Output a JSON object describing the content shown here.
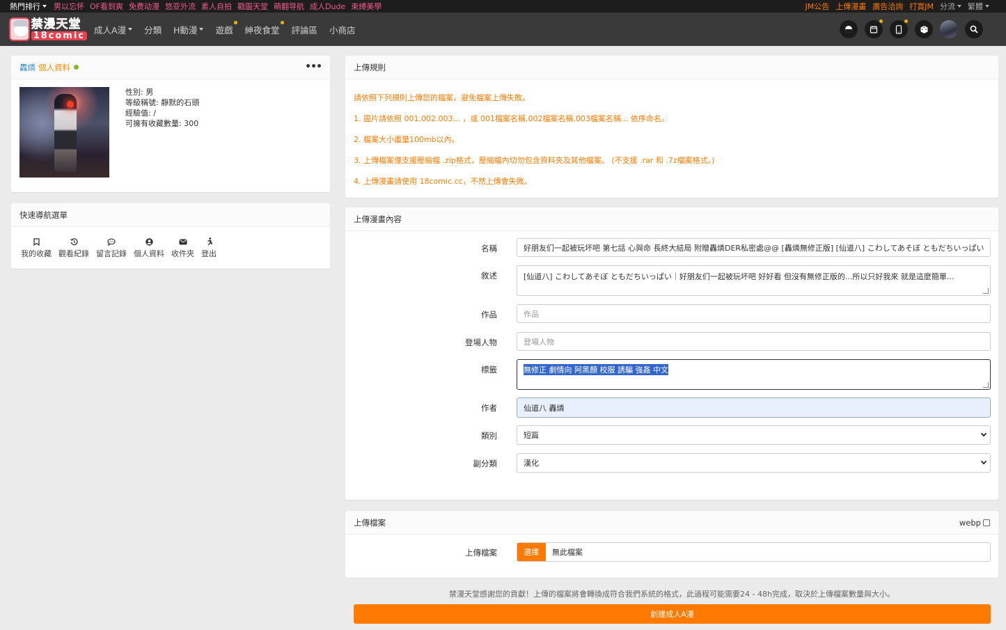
{
  "topbar": {
    "hot_label": "熱門排行",
    "links": [
      "男以忘怀",
      "OF看到爽",
      "免费动漫",
      "悠亚外流",
      "素人自拍",
      "戳圖天堂",
      "萌翻导航",
      "成人Dude",
      "束縛美學"
    ],
    "right_links": [
      "JM公告",
      "上傳漫畫",
      "廣告洽詢",
      "打賞JM"
    ],
    "split_label": "分流",
    "lang_label": "繁體"
  },
  "logo": {
    "line1": "禁漫天堂",
    "line2": "18comic"
  },
  "nav": {
    "items": [
      {
        "label": "成人A漫",
        "dropdown": true,
        "dot": false
      },
      {
        "label": "分類",
        "dropdown": false,
        "dot": false
      },
      {
        "label": "H動漫",
        "dropdown": true,
        "dot": false
      },
      {
        "label": "遊戲",
        "dropdown": false,
        "dot": true
      },
      {
        "label": "紳夜食堂",
        "dropdown": false,
        "dot": true
      },
      {
        "label": "評論區",
        "dropdown": false,
        "dot": false
      },
      {
        "label": "小商店",
        "dropdown": false,
        "dot": false
      }
    ],
    "icons": [
      "theme-toggle-icon",
      "calendar-icon",
      "mobile-icon",
      "dice-icon",
      "user-avatar",
      "search-icon"
    ]
  },
  "profile": {
    "username": "轟燐",
    "title_suffix": "個人資料",
    "status": "online",
    "gender": "性別: 男",
    "rank": "等級稱號: 靜默的石頭",
    "exp": "經驗值: /",
    "fav_limit": "可擁有收藏數量: 300"
  },
  "quicknav": {
    "title": "快速導航選單",
    "items": [
      {
        "label": "我的收藏",
        "icon": "bookmark-icon"
      },
      {
        "label": "觀看紀錄",
        "icon": "history-icon"
      },
      {
        "label": "留言記錄",
        "icon": "comment-icon"
      },
      {
        "label": "個人資料",
        "icon": "user-circle-icon"
      },
      {
        "label": "收件夾",
        "icon": "envelope-icon"
      },
      {
        "label": "登出",
        "icon": "running-icon"
      }
    ]
  },
  "rules": {
    "title": "上傳規則",
    "lines": [
      "請依照下列規則上傳您的檔案，避免檔案上傳失敗。",
      "1. 圖片請依照 001.002.003... ，或 001檔案名稱.002檔案名稱.003檔案名稱... 依序命名。",
      "2. 檔案大小盡量100mb以內。",
      "3. 上傳檔案僅支援壓縮檔 .zip格式，壓縮檔內切勿包含資料夾及其他檔案。 (不支援 .rar 和 .7z檔案格式。)",
      "4. 上傳漫畫請使用 18comic.cc，不然上傳會失敗。"
    ]
  },
  "upload_form": {
    "title": "上傳漫畫內容",
    "name_label": "名稱",
    "name_value": "好朋友们一起被玩坏吧 第七話 心與命 長終大結局 附贈轟燐DER私密處@@ [轟燐無修正版] [仙道八] こわしてあそぼ ともだちいっぱい",
    "desc_label": "敘述",
    "desc_value": "[仙道八] こわしてあそぼ ともだちいっぱい｜好朋友们一起被玩坏吧 好好看 但沒有無修正版的...所以只好我來 就是這麼簡單...",
    "work_label": "作品",
    "work_placeholder": "作品",
    "chars_label": "登場人物",
    "chars_placeholder": "登場人物",
    "tags_label": "標籤",
    "tags_value": "無修正 劇情向 阿黑顏 校服 誘騙 強姦 中文",
    "author_label": "作者",
    "author_value": "仙道八 轟燐",
    "category_label": "類別",
    "category_value": "短篇",
    "subcategory_label": "副分類",
    "subcategory_value": "漢化"
  },
  "files": {
    "title": "上傳檔案",
    "webp_label": "webp",
    "file_label": "上傳檔案",
    "choose_label": "選擇",
    "no_file": "無此檔案"
  },
  "footer": {
    "thanks": "禁漫天堂感謝您的貢獻！上傳的檔案將會轉換成符合我們系統的格式，此過程可能需要24 - 48h完成，取決於上傳檔案數量與大小。",
    "submit_label": "創建成人A漫"
  },
  "colors": {
    "accent": "#ff7a00",
    "pink_link": "#f05a8c",
    "navbar": "#3a3a3a",
    "online": "#7cba1f"
  }
}
